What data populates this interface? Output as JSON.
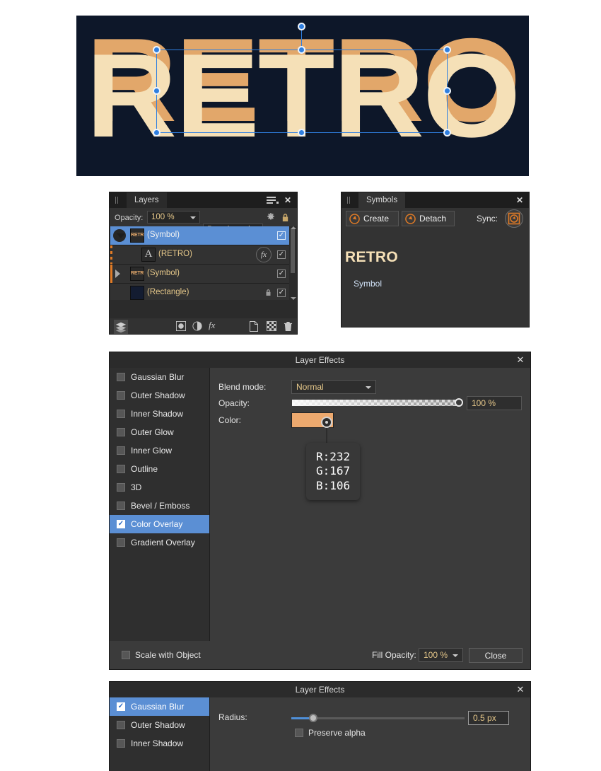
{
  "canvas": {
    "word": "RETRO",
    "background_color": "#0d1729",
    "front_color": "#f5e0b7",
    "back_color": "#e2a76a",
    "selection_color": "#2f7fe0"
  },
  "layers_panel": {
    "tab_label": "Layers",
    "close_icon": "✕",
    "menu_icon": "panel-menu-icon",
    "opacity_label": "Opacity:",
    "opacity_value": "100 %",
    "blend_mode": "Passthrough",
    "gear_icon": "gear-icon",
    "lock_icon": "lock-icon",
    "rows": [
      {
        "name": "(Symbol)",
        "thumb": "RETRO",
        "thumb_type": "symbol",
        "selected": true,
        "expanded": true,
        "has_fx": false,
        "locked": false,
        "visible": true,
        "indent": false
      },
      {
        "name": "(RETRO)",
        "thumb": "A",
        "thumb_type": "text",
        "selected": false,
        "expanded": null,
        "has_fx": true,
        "locked": false,
        "visible": true,
        "indent": true
      },
      {
        "name": "(Symbol)",
        "thumb": "RETRO",
        "thumb_type": "symbol",
        "selected": false,
        "expanded": false,
        "has_fx": false,
        "locked": false,
        "visible": true,
        "indent": false
      },
      {
        "name": "(Rectangle)",
        "thumb": "",
        "thumb_type": "rectangle",
        "selected": false,
        "expanded": null,
        "has_fx": false,
        "locked": true,
        "visible": true,
        "indent": false
      }
    ],
    "toolbar_icons": [
      "layers-stack-icon",
      "mask-icon",
      "adjustment-icon",
      "fx-icon",
      "new-layer-icon",
      "checker-icon",
      "delete-icon"
    ],
    "fx_glyph": "fx",
    "check_glyph": "✓"
  },
  "symbols_panel": {
    "tab_label": "Symbols",
    "close_icon": "✕",
    "create_label": "Create",
    "detach_label": "Detach",
    "sync_label": "Sync:",
    "sync_icon": "sync-icon",
    "symbol_preview_text": "RETRO",
    "symbol_name": "Symbol"
  },
  "effects_dialog": {
    "title": "Layer Effects",
    "close_icon": "✕",
    "effects": [
      {
        "label": "Gaussian Blur",
        "checked": false,
        "selected": false
      },
      {
        "label": "Outer Shadow",
        "checked": false,
        "selected": false
      },
      {
        "label": "Inner Shadow",
        "checked": false,
        "selected": false
      },
      {
        "label": "Outer Glow",
        "checked": false,
        "selected": false
      },
      {
        "label": "Inner Glow",
        "checked": false,
        "selected": false
      },
      {
        "label": "Outline",
        "checked": false,
        "selected": false
      },
      {
        "label": "3D",
        "checked": false,
        "selected": false
      },
      {
        "label": "Bevel / Emboss",
        "checked": false,
        "selected": false
      },
      {
        "label": "Color Overlay",
        "checked": true,
        "selected": true
      },
      {
        "label": "Gradient Overlay",
        "checked": false,
        "selected": false
      }
    ],
    "blend_mode_label": "Blend mode:",
    "blend_mode_value": "Normal",
    "opacity_label": "Opacity:",
    "opacity_value": "100 %",
    "color_label": "Color:",
    "color_swatch": "#eda96e",
    "tooltip": {
      "r": "R:232",
      "g": "G:167",
      "b": "B:106"
    },
    "scale_with_object_label": "Scale with Object",
    "scale_with_object_checked": false,
    "fill_opacity_label": "Fill Opacity:",
    "fill_opacity_value": "100 %",
    "close_button_label": "Close"
  },
  "blur_dialog": {
    "title": "Layer Effects",
    "close_icon": "✕",
    "effects": [
      {
        "label": "Gaussian Blur",
        "checked": true,
        "selected": true
      },
      {
        "label": "Outer Shadow",
        "checked": false,
        "selected": false
      },
      {
        "label": "Inner Shadow",
        "checked": false,
        "selected": false
      }
    ],
    "radius_label": "Radius:",
    "radius_value": "0.5 px",
    "radius_percent": 12,
    "preserve_alpha_label": "Preserve alpha",
    "preserve_alpha_checked": false
  }
}
